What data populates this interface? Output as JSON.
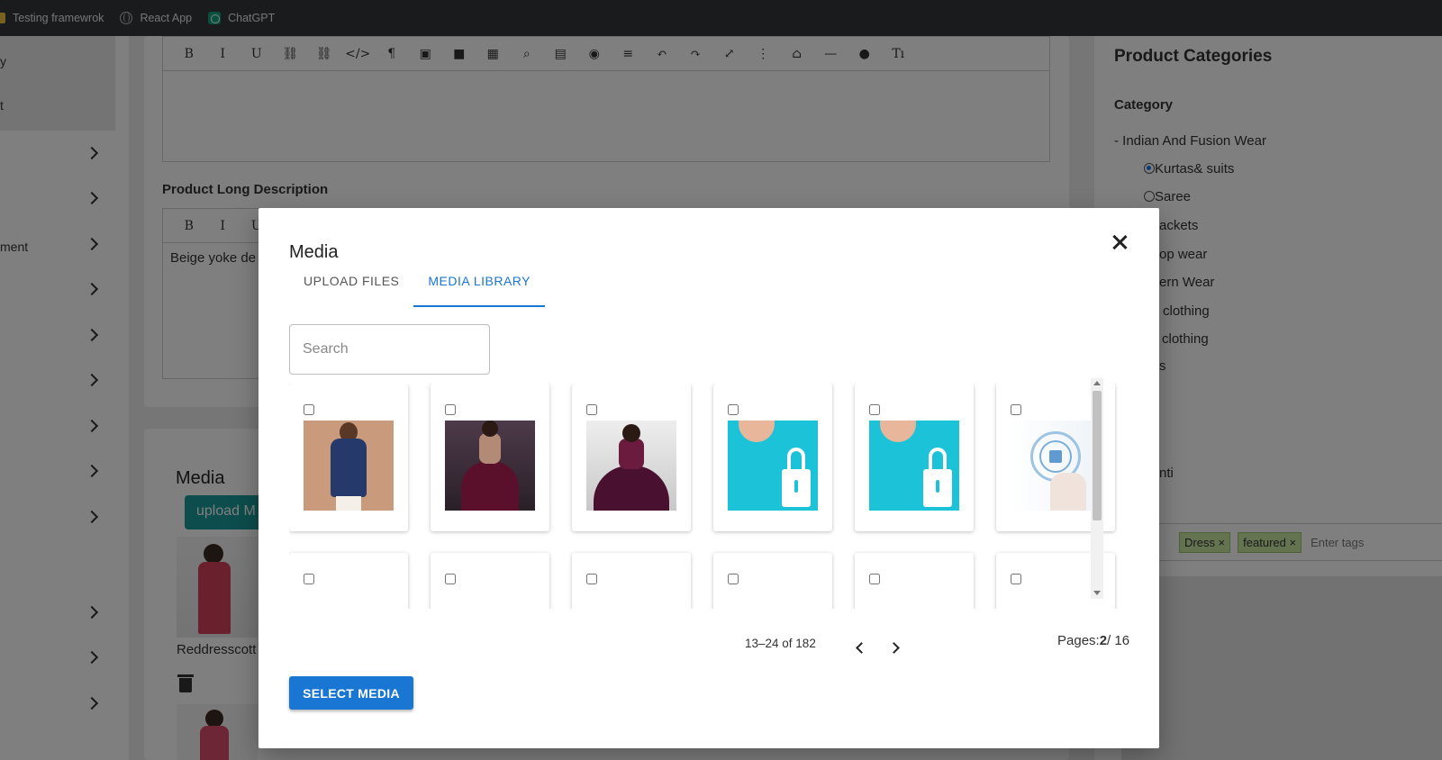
{
  "bookmarks": [
    {
      "label": "Testing framewrok",
      "icon": "folder-icon"
    },
    {
      "label": "React App",
      "icon": "globe-icon"
    },
    {
      "label": "ChatGPT",
      "icon": "chatgpt-icon"
    }
  ],
  "sidebar": {
    "items": [
      {
        "label": "y"
      },
      {
        "label": "t"
      },
      {
        "label": "ment"
      }
    ]
  },
  "editor": {
    "toolbar_icons": [
      "B",
      "I",
      "U",
      "⛓",
      "⛓",
      "</>",
      "¶",
      "▣",
      "■",
      "▦",
      "⌕",
      "▤",
      "◉",
      "≡",
      "↶",
      "↷",
      "⤢",
      "⋮",
      "⌂",
      "—",
      "●",
      "Tı"
    ]
  },
  "product_long_description": {
    "label": "Product Long Description",
    "text": "Beige yoke de"
  },
  "media_section": {
    "heading": "Media",
    "upload_button": "upload M",
    "filename": "Reddresscott"
  },
  "right_panel": {
    "title": "Product Categories",
    "category_label": "Category",
    "parent_category": "- Indian And Fusion Wear",
    "options": [
      {
        "label": "Kurtas& suits",
        "selected": true
      },
      {
        "label": "Saree",
        "selected": false
      }
    ],
    "partial_items": [
      "ackets",
      "op wear",
      "ern Wear",
      "clothing",
      "clothing",
      "s",
      "nti"
    ],
    "tags": [
      "Dress ×",
      "featured ×"
    ],
    "tags_placeholder": "Enter tags"
  },
  "modal": {
    "title": "Media",
    "tabs": [
      {
        "label": "UPLOAD FILES",
        "active": false
      },
      {
        "label": "MEDIA LIBRARY",
        "active": true
      }
    ],
    "search_placeholder": "Search",
    "thumbnails": [
      {
        "kind": "kurta-photo"
      },
      {
        "kind": "lehenga-photo"
      },
      {
        "kind": "lehenga-photo"
      },
      {
        "kind": "padlock-photo"
      },
      {
        "kind": "padlock-photo"
      },
      {
        "kind": "security-shield-photo"
      }
    ],
    "pagination": {
      "range": "13–24 of 182",
      "pages_label": "Pages:",
      "current_page": "2",
      "total_pages": "/ 16"
    },
    "select_button": "SELECT MEDIA"
  },
  "colors": {
    "accent": "#1976d2",
    "upload_button": "#1a9b9b",
    "tag_bg": "#c8e6a0"
  }
}
